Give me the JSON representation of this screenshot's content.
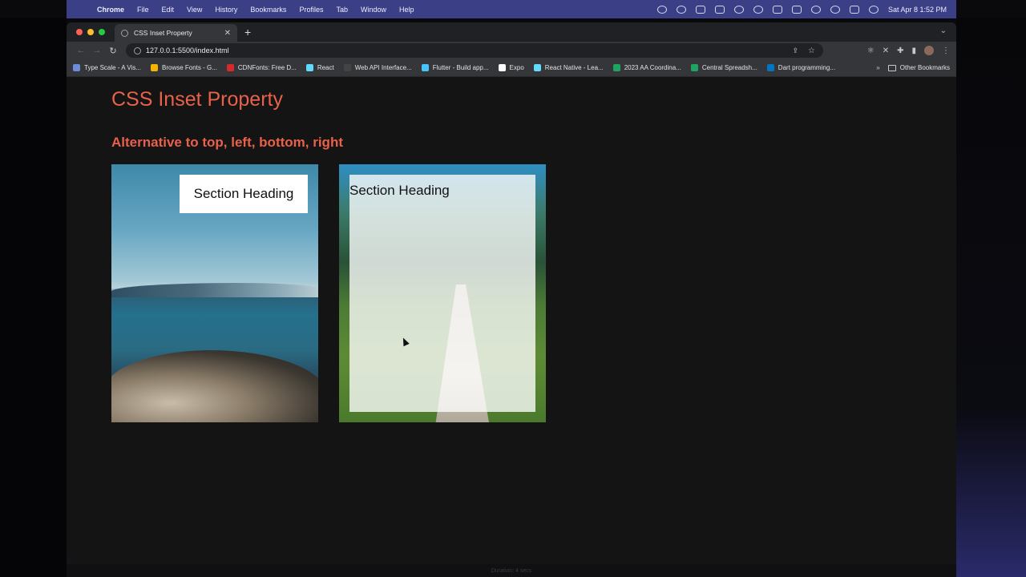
{
  "menubar": {
    "app_name": "Chrome",
    "menus": [
      "File",
      "Edit",
      "View",
      "History",
      "Bookmarks",
      "Profiles",
      "Tab",
      "Window",
      "Help"
    ],
    "clock": "Sat Apr 8  1:52 PM"
  },
  "browser": {
    "tab_title": "CSS Inset Property",
    "url": "127.0.0.1:5500/index.html",
    "bookmarks": [
      {
        "label": "Type Scale - A Vis...",
        "color": "#6e8bd8"
      },
      {
        "label": "Browse Fonts - G...",
        "color": "#f4b400"
      },
      {
        "label": "CDNFonts: Free D...",
        "color": "#d62a2a"
      },
      {
        "label": "React",
        "color": "#61dafb"
      },
      {
        "label": "Web API Interface...",
        "color": "#444444"
      },
      {
        "label": "Flutter - Build app...",
        "color": "#47c5fb"
      },
      {
        "label": "Expo",
        "color": "#ffffff"
      },
      {
        "label": "React Native - Lea...",
        "color": "#61dafb"
      },
      {
        "label": "2023 AA Coordina...",
        "color": "#1fa463"
      },
      {
        "label": "Central Spreadsh...",
        "color": "#1fa463"
      },
      {
        "label": "Dart programming...",
        "color": "#0175c2"
      }
    ],
    "bookmarks_more": "»",
    "other_bookmarks": "Other Bookmarks"
  },
  "page": {
    "title": "CSS Inset Property",
    "subtitle": "Alternative to top, left, bottom, right",
    "card1_heading": "Section Heading",
    "card2_heading": "Section Heading"
  },
  "statusbar": {
    "text": "Duration: 4 secs"
  },
  "colors": {
    "accent": "#e8614a",
    "menubar": "#3b3f86",
    "page_bg": "#141414"
  }
}
